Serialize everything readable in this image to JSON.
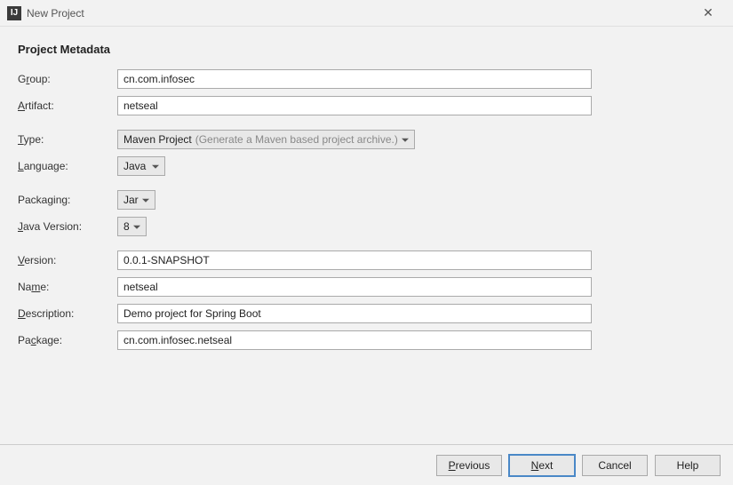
{
  "window": {
    "title": "New Project",
    "icon_text": "IJ"
  },
  "heading": "Project Metadata",
  "fields": {
    "group": {
      "label_pre": "G",
      "label_u": "r",
      "label_post": "oup:",
      "value": "cn.com.infosec"
    },
    "artifact": {
      "label_pre": "",
      "label_u": "A",
      "label_post": "rtifact:",
      "value": "netseal"
    },
    "type": {
      "label_pre": "",
      "label_u": "T",
      "label_post": "ype:",
      "value": "Maven Project",
      "hint": "(Generate a Maven based project archive.)"
    },
    "language": {
      "label_pre": "",
      "label_u": "L",
      "label_post": "anguage:",
      "value": "Java"
    },
    "packaging": {
      "label_pre": "Packa",
      "label_u": "g",
      "label_post": "ing:",
      "value": "Jar"
    },
    "javaVersion": {
      "label_pre": "",
      "label_u": "J",
      "label_post": "ava Version:",
      "value": "8"
    },
    "version": {
      "label_pre": "",
      "label_u": "V",
      "label_post": "ersion:",
      "value": "0.0.1-SNAPSHOT"
    },
    "name": {
      "label_pre": "Na",
      "label_u": "m",
      "label_post": "e:",
      "value": "netseal"
    },
    "description": {
      "label_pre": "",
      "label_u": "D",
      "label_post": "escription:",
      "value": "Demo project for Spring Boot"
    },
    "package": {
      "label_pre": "Pa",
      "label_u": "c",
      "label_post": "kage:",
      "value": "cn.com.infosec.netseal"
    }
  },
  "buttons": {
    "previous": {
      "pre": "",
      "u": "P",
      "post": "revious"
    },
    "next": {
      "pre": "",
      "u": "N",
      "post": "ext"
    },
    "cancel": "Cancel",
    "help": "Help"
  }
}
